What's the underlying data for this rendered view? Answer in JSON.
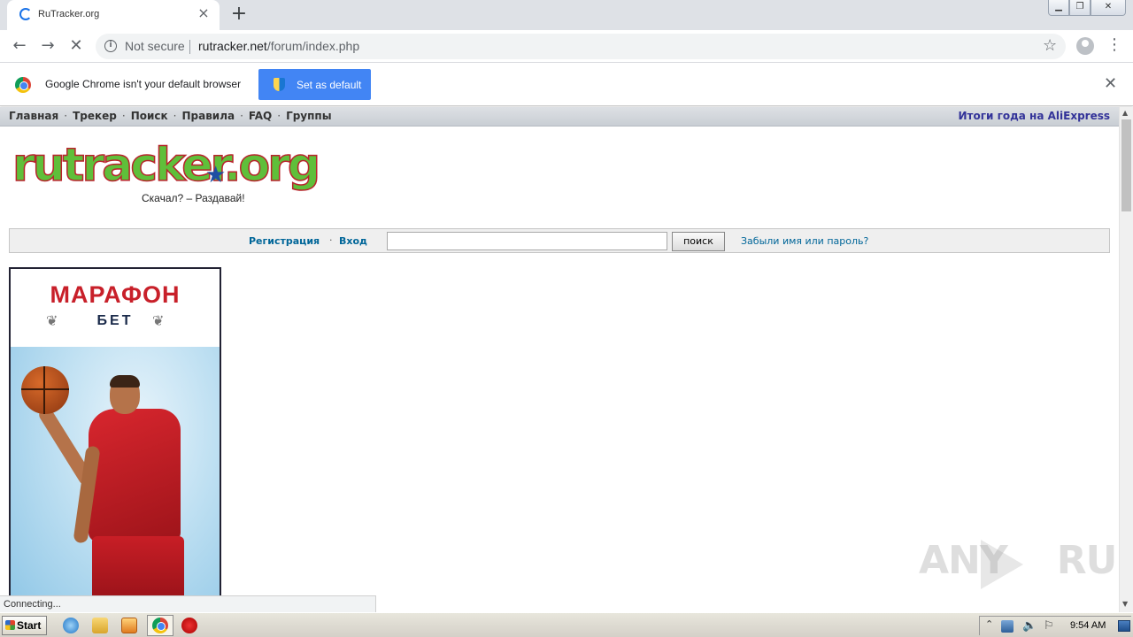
{
  "browser": {
    "tab_title": "RuTracker.org",
    "tab_close": "×",
    "new_tab": "+",
    "window_min": "▁",
    "window_max": "❐",
    "window_close": "✕",
    "back": "←",
    "forward": "→",
    "reload": "✕",
    "security_label": "Not secure",
    "url_host": "rutracker.net",
    "url_path": "/forum/index.php",
    "star": "☆",
    "menu": "⋮"
  },
  "infobar": {
    "message": "Google Chrome isn't your default browser",
    "button_label": "Set as default",
    "close": "✕"
  },
  "site": {
    "nav": [
      "Главная",
      "Трекер",
      "Поиск",
      "Правила",
      "FAQ",
      "Группы"
    ],
    "nav_right": "Итоги года на AliExpress",
    "logo_text": "rutracker.org",
    "logo_star": "★",
    "tagline": "Скачал? – Раздавай!",
    "register": "Регистрация",
    "dot": "·",
    "login": "Вход",
    "search_value": "",
    "search_button": "поиск",
    "forgot": "Забыли имя или пароль?"
  },
  "ad": {
    "title": "МАРАФОН",
    "subtitle": "БЕТ",
    "laurel": "❦"
  },
  "status": {
    "text": "Connecting..."
  },
  "scrollbar": {
    "up": "▲",
    "down": "▼"
  },
  "watermark": {
    "left": "ANY",
    "right": "RUN"
  },
  "taskbar": {
    "start_label": "Start",
    "tray_arrow": "⌃",
    "volume": "🔈",
    "flag": "⚐",
    "clock": "9:54 AM"
  },
  "colors": {
    "chrome_accent": "#4285f4",
    "link": "#006699",
    "ad_red": "#c8202a"
  }
}
